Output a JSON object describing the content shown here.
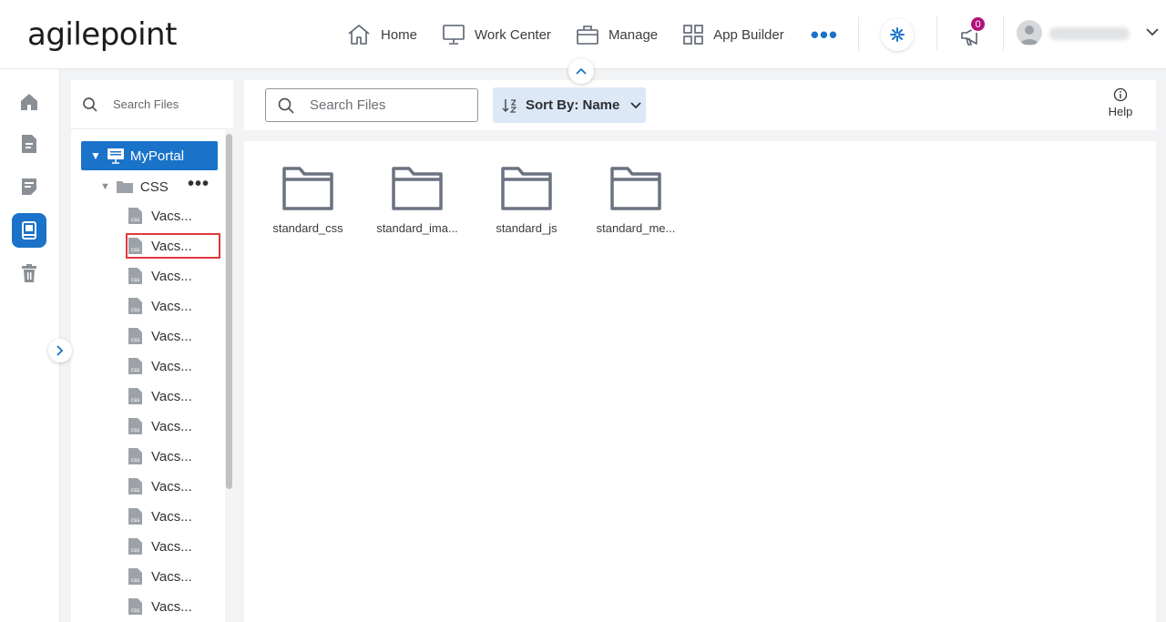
{
  "header": {
    "logo": "agilepoint",
    "nav": [
      {
        "label": "Home",
        "icon": "home-icon"
      },
      {
        "label": "Work Center",
        "icon": "monitor-icon"
      },
      {
        "label": "Manage",
        "icon": "briefcase-icon"
      },
      {
        "label": "App Builder",
        "icon": "grid-icon"
      }
    ],
    "more": "•••",
    "notification_count": "0"
  },
  "rail": {
    "items": [
      "home-icon",
      "document-icon",
      "forms-icon",
      "file-library-icon",
      "trash-icon"
    ],
    "active_index": 3
  },
  "tree": {
    "search_placeholder": "Search Files",
    "root": "MyPortal",
    "folder": "CSS",
    "folder_more": "•••",
    "file_icon_text": "css",
    "files": [
      "Vacs...",
      "Vacs...",
      "Vacs...",
      "Vacs...",
      "Vacs...",
      "Vacs...",
      "Vacs...",
      "Vacs...",
      "Vacs...",
      "Vacs...",
      "Vacs...",
      "Vacs...",
      "Vacs...",
      "Vacs..."
    ],
    "highlighted_index": 1
  },
  "toolbar": {
    "search_placeholder": "Search Files",
    "sort_label": "Sort By: Name",
    "help_label": "Help"
  },
  "folders": [
    "standard_css",
    "standard_ima...",
    "standard_js",
    "standard_me..."
  ],
  "colors": {
    "accent": "#1a73c8",
    "badge": "#b0127a",
    "highlight_border": "#e0393e",
    "sort_bg": "#dde8f6"
  }
}
